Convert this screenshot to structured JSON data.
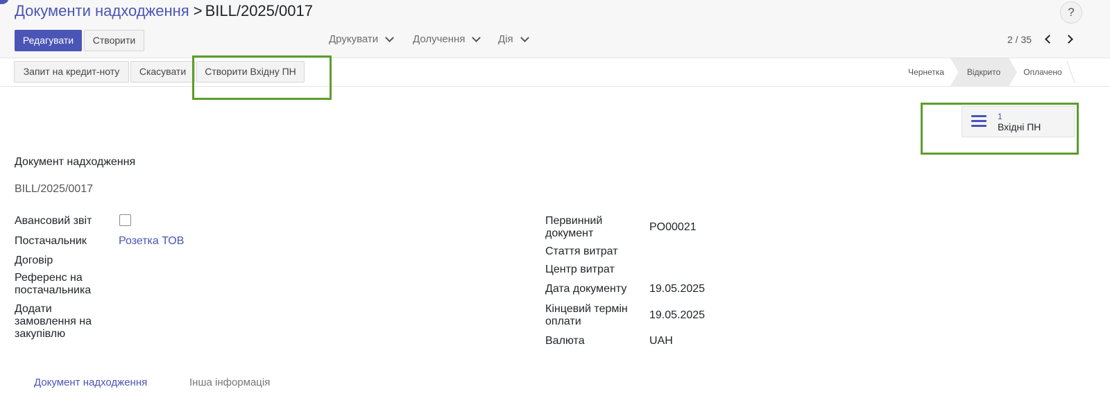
{
  "breadcrumb": {
    "parent": "Документи надходження",
    "separator": ">",
    "current": "BILL/2025/0017"
  },
  "help_label": "?",
  "toolbar": {
    "edit_label": "Редагувати",
    "create_label": "Створити",
    "print_label": "Друкувати",
    "attach_label": "Долучення",
    "action_label": "Дія"
  },
  "pager": {
    "value": "2 / 35"
  },
  "status_actions": {
    "credit_note_label": "Запит на кредит-ноту",
    "cancel_label": "Скасувати",
    "create_receipt_label": "Створити Вхідну ПН"
  },
  "stages": [
    {
      "label": "Чернетка"
    },
    {
      "label": "Відкрито"
    },
    {
      "label": "Оплачено"
    }
  ],
  "smart_button": {
    "count": "1",
    "label": "Вхідні ПН"
  },
  "form": {
    "title_label": "Документ надходження",
    "title_value": "BILL/2025/0017",
    "left": {
      "advance_label": "Авансовий звіт",
      "vendor_label": "Постачальник",
      "vendor_value": "Розетка ТОВ",
      "contract_label": "Договір",
      "vendor_ref_label": "Референс на постачальника",
      "add_po_label": "Додати замовлення на закупівлю"
    },
    "right": {
      "source_doc_label": "Первинний документ",
      "source_doc_value": "PO00021",
      "expense_item_label": "Стаття витрат",
      "cost_center_label": "Центр витрат",
      "doc_date_label": "Дата документу",
      "doc_date_value": "19.05.2025",
      "due_date_label": "Кінцевий термін оплати",
      "due_date_value": "19.05.2025",
      "currency_label": "Валюта",
      "currency_value": "UAH"
    }
  },
  "tabs": [
    {
      "label": "Документ надходження"
    },
    {
      "label": "Інша інформація"
    }
  ],
  "colors": {
    "accent": "#4a55b5",
    "highlight": "#5a9e2b"
  }
}
